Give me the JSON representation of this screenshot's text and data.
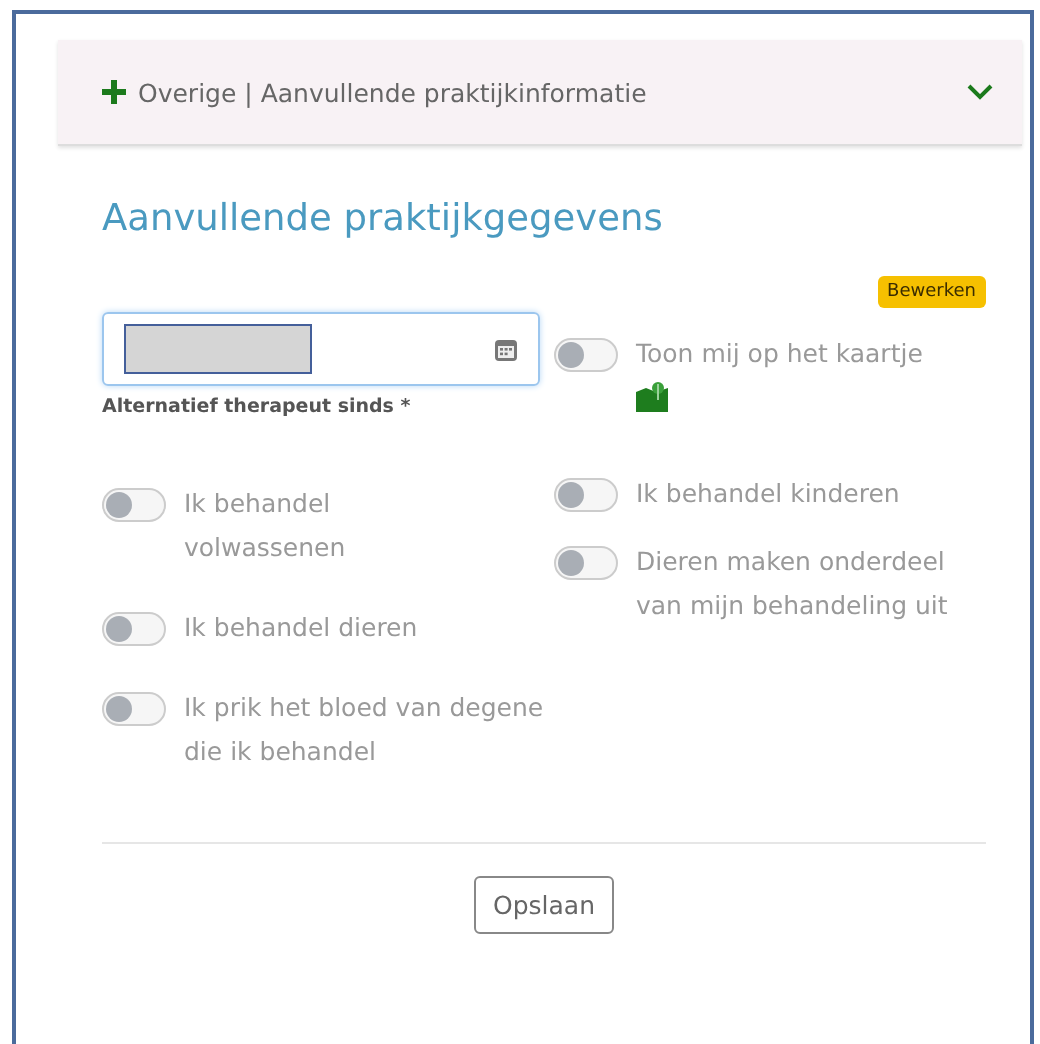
{
  "header": {
    "title": "Overige | Aanvullende praktijkinformatie",
    "expanded": true
  },
  "section_title": "Aanvullende praktijkgegevens",
  "edit_badge": "Bewerken",
  "date_field": {
    "label": "Alternatief therapeut sinds *"
  },
  "map_toggle": {
    "label": "Toon mij op het kaartje",
    "on": false
  },
  "left_toggles": [
    {
      "label": "Ik behandel volwassenen",
      "on": false
    },
    {
      "label": "Ik behandel dieren",
      "on": false
    },
    {
      "label": "Ik prik het bloed van degene die ik behandel",
      "on": false
    }
  ],
  "right_toggles": [
    {
      "label": "Ik behandel kinderen",
      "on": false
    },
    {
      "label": "Dieren maken onderdeel van mijn behandeling uit",
      "on": false
    }
  ],
  "save_button": "Opslaan"
}
